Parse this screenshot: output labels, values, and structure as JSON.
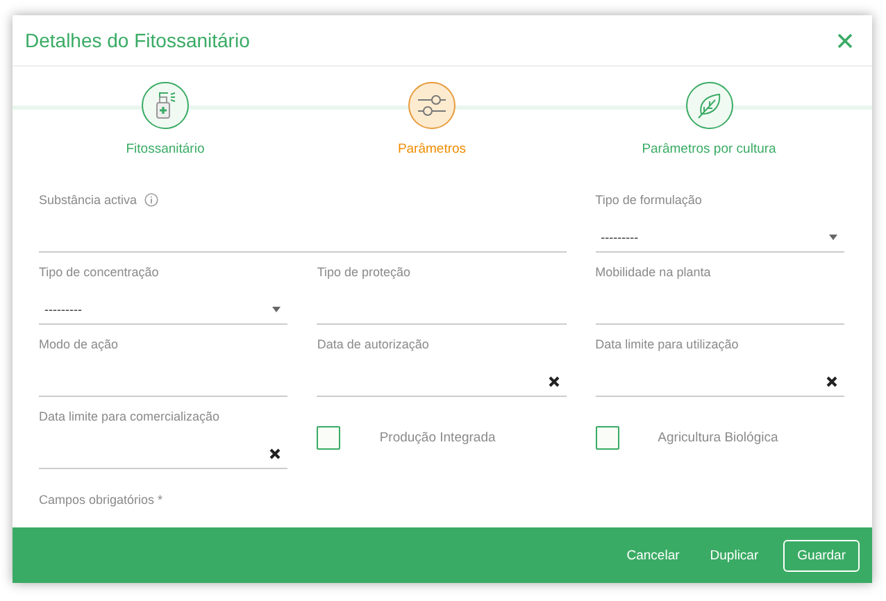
{
  "dialog": {
    "title": "Detalhes do Fitossanitário"
  },
  "steps": [
    {
      "label": "Fitossanitário",
      "selected": false
    },
    {
      "label": "Parâmetros",
      "selected": true
    },
    {
      "label": "Parâmetros por cultura",
      "selected": false
    }
  ],
  "fields": [
    {
      "kind": "text",
      "label": "Substância activa",
      "info": true,
      "wide": true
    },
    {
      "kind": "select",
      "label": "Tipo de formulação",
      "value": "---------"
    },
    {
      "kind": "select",
      "label": "Tipo de concentração",
      "value": "---------"
    },
    {
      "kind": "text",
      "label": "Tipo de proteção"
    },
    {
      "kind": "text",
      "label": "Mobilidade na planta"
    },
    {
      "kind": "text",
      "label": "Modo de ação"
    },
    {
      "kind": "date",
      "label": "Data de autorização"
    },
    {
      "kind": "date",
      "label": "Data limite para utilização"
    },
    {
      "kind": "date",
      "label": "Data limite para comercialização"
    },
    {
      "kind": "checkbox",
      "label": "Produção Integrada",
      "checked": false
    },
    {
      "kind": "checkbox",
      "label": "Agricultura Biológica",
      "checked": false
    }
  ],
  "required_note": "Campos obrigatórios *",
  "buttons": [
    {
      "label": "Cancelar",
      "kind": "text"
    },
    {
      "label": "Duplicar",
      "kind": "text"
    },
    {
      "label": "Guardar",
      "kind": "outlined"
    }
  ]
}
